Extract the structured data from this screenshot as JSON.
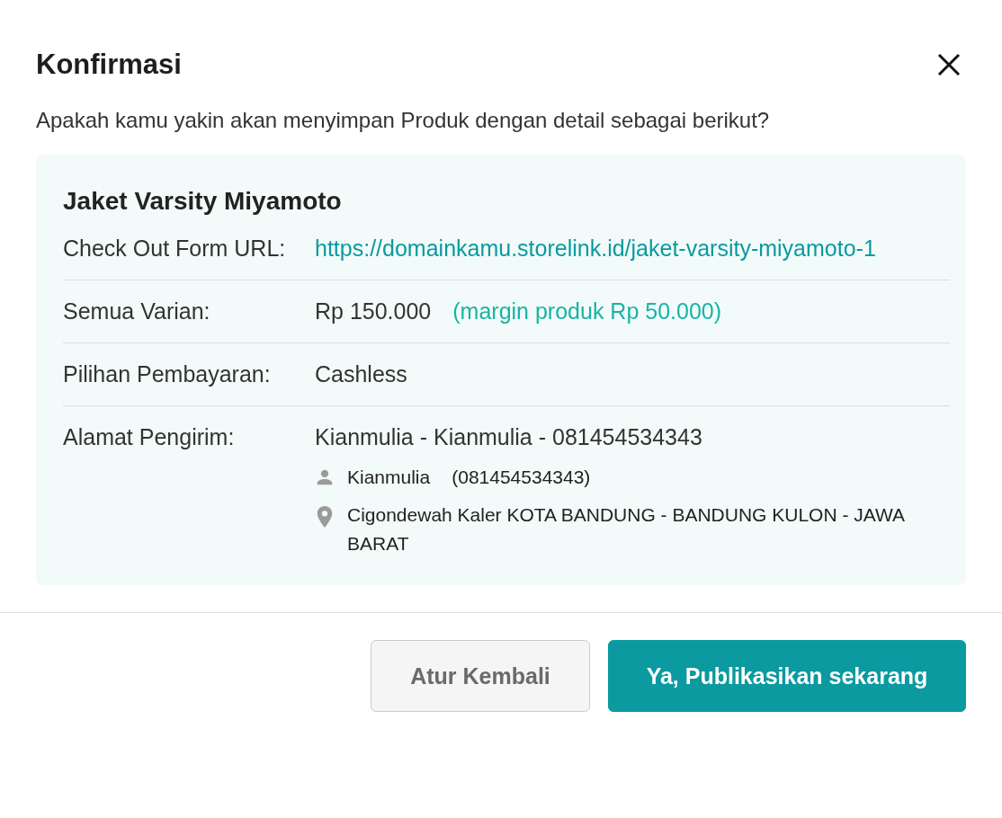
{
  "dialog": {
    "title": "Konfirmasi",
    "question": "Apakah kamu yakin akan menyimpan Produk dengan detail sebagai berikut?"
  },
  "product": {
    "name": "Jaket Varsity Miyamoto",
    "rows": [
      {
        "kind": "link",
        "label": "Check Out Form URL:",
        "value": "https://domainkamu.storelink.id/jaket-varsity-miyamoto-1"
      },
      {
        "kind": "price",
        "label": "Semua Varian:",
        "value": "Rp 150.000",
        "note": "(margin produk Rp 50.000)"
      },
      {
        "kind": "text",
        "label": "Pilihan Pembayaran:",
        "value": "Cashless"
      },
      {
        "kind": "address",
        "label": "Alamat Pengirim:",
        "value": "Kianmulia - Kianmulia - 081454534343",
        "recipient": "Kianmulia",
        "phone": "(081454534343)",
        "address": "Cigondewah Kaler KOTA BANDUNG - BANDUNG KULON - JAWA BARAT"
      }
    ]
  },
  "buttons": [
    {
      "kind": "secondary",
      "label": "Atur Kembali"
    },
    {
      "kind": "primary",
      "label": "Ya, Publikasikan sekarang"
    }
  ]
}
